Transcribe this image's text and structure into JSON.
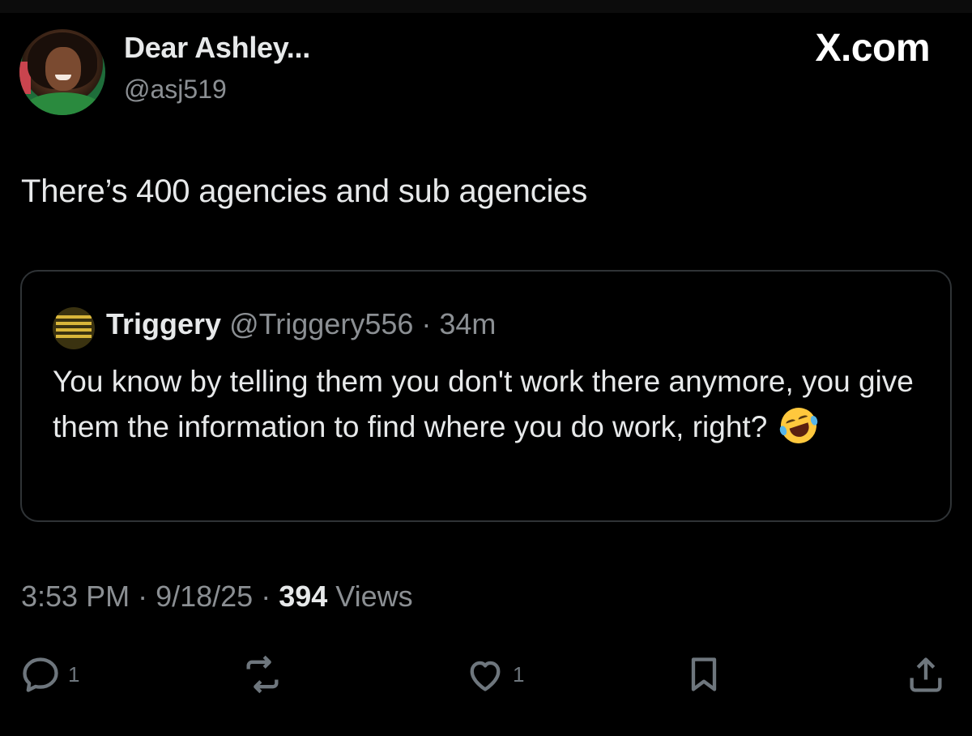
{
  "author": {
    "display_name": "Dear Ashley...",
    "handle": "@asj519"
  },
  "brand": {
    "label": "X.com"
  },
  "tweet": {
    "text": "There’s 400 agencies and sub agencies"
  },
  "quoted": {
    "name": "Triggery",
    "handle": "@Triggery556",
    "separator": " · ",
    "time": "34m",
    "text": "You know by telling them you don't work there anymore, you give them the information to find where you do work, right?"
  },
  "meta": {
    "time": "3:53 PM",
    "sep1": " · ",
    "date": "9/18/25",
    "sep2": " · ",
    "views_count": "394",
    "views_label": " Views"
  },
  "actions": {
    "reply_count": "1",
    "like_count": "1"
  },
  "colors": {
    "background": "#000000",
    "text": "#e7e9ea",
    "muted": "#8b8f93",
    "border": "#2f3336"
  }
}
